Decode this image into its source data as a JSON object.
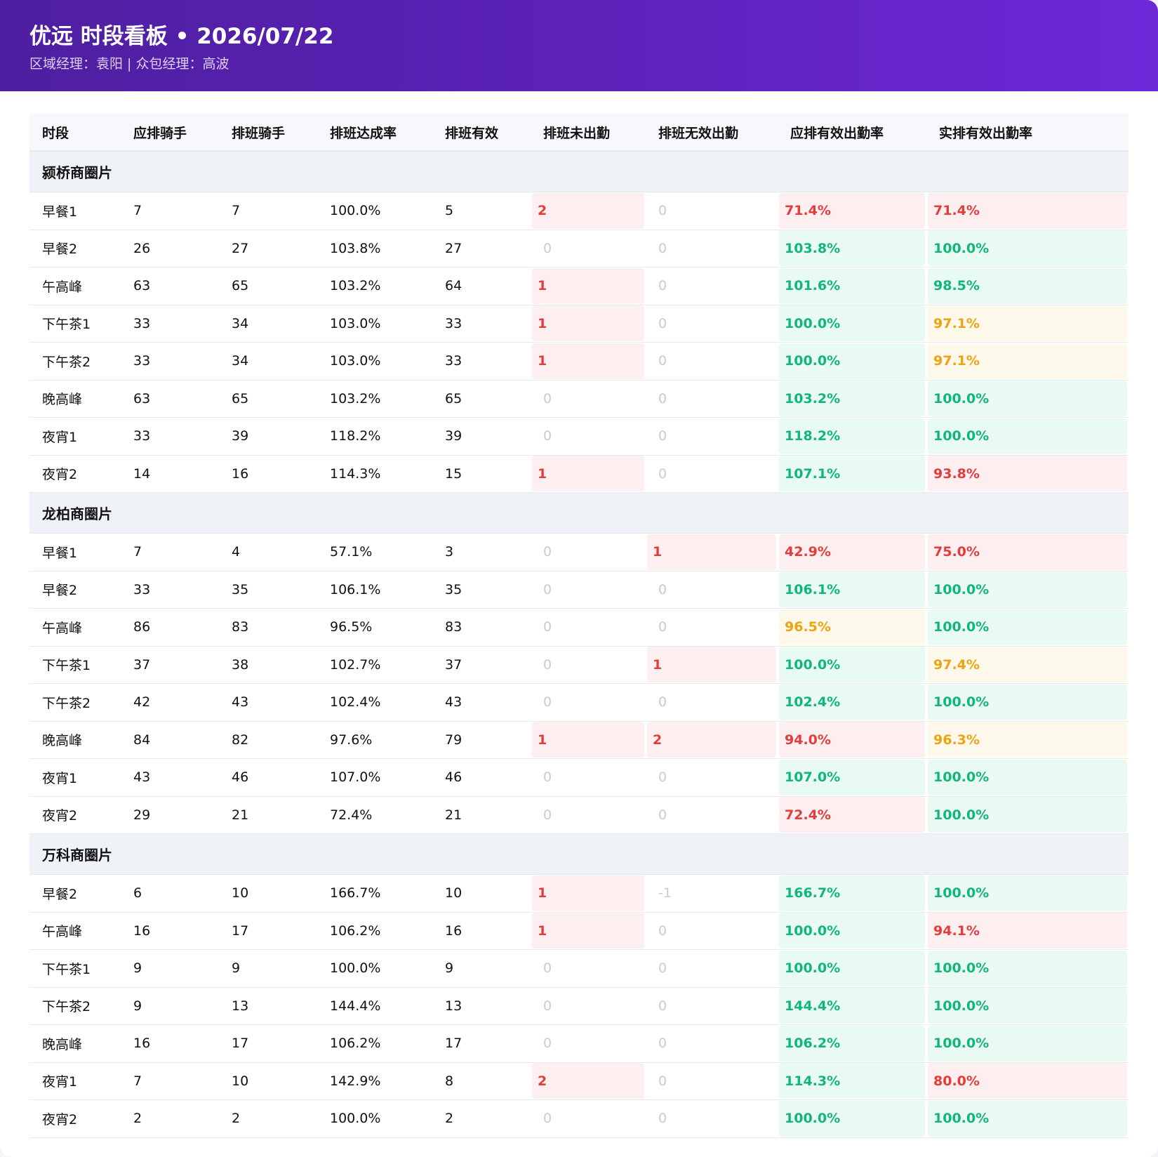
{
  "header": {
    "title": "优远 时段看板 • 2026/07/22",
    "subtitle": "区域经理：袁阳 | 众包经理：高波"
  },
  "columns": [
    "时段",
    "应排骑手",
    "排班骑手",
    "排班达成率",
    "排班有效",
    "排班未出勤",
    "排班无效出勤",
    "应排有效出勤率",
    "实排有效出勤率"
  ],
  "colors": {
    "red": "#e23c3c",
    "green": "#12b57a",
    "yellow": "#eea214",
    "header_start": "#4e1fa0",
    "header_end": "#6d28d9"
  },
  "groups": [
    {
      "name": "颍桥商圈片",
      "rows": [
        {
          "slot": "早餐1",
          "should": "7",
          "scheduled": "7",
          "rate": "100.0%",
          "valid": "5",
          "absent": "2",
          "invalid": "0",
          "should_rate": "71.4%",
          "actual_rate": "71.4%",
          "absent_status": "red",
          "invalid_status": "zero",
          "should_status": "red",
          "actual_status": "red"
        },
        {
          "slot": "早餐2",
          "should": "26",
          "scheduled": "27",
          "rate": "103.8%",
          "valid": "27",
          "absent": "0",
          "invalid": "0",
          "should_rate": "103.8%",
          "actual_rate": "100.0%",
          "absent_status": "zero",
          "invalid_status": "zero",
          "should_status": "green",
          "actual_status": "green"
        },
        {
          "slot": "午高峰",
          "should": "63",
          "scheduled": "65",
          "rate": "103.2%",
          "valid": "64",
          "absent": "1",
          "invalid": "0",
          "should_rate": "101.6%",
          "actual_rate": "98.5%",
          "absent_status": "red",
          "invalid_status": "zero",
          "should_status": "green",
          "actual_status": "green"
        },
        {
          "slot": "下午茶1",
          "should": "33",
          "scheduled": "34",
          "rate": "103.0%",
          "valid": "33",
          "absent": "1",
          "invalid": "0",
          "should_rate": "100.0%",
          "actual_rate": "97.1%",
          "absent_status": "red",
          "invalid_status": "zero",
          "should_status": "green",
          "actual_status": "yellow"
        },
        {
          "slot": "下午茶2",
          "should": "33",
          "scheduled": "34",
          "rate": "103.0%",
          "valid": "33",
          "absent": "1",
          "invalid": "0",
          "should_rate": "100.0%",
          "actual_rate": "97.1%",
          "absent_status": "red",
          "invalid_status": "zero",
          "should_status": "green",
          "actual_status": "yellow"
        },
        {
          "slot": "晚高峰",
          "should": "63",
          "scheduled": "65",
          "rate": "103.2%",
          "valid": "65",
          "absent": "0",
          "invalid": "0",
          "should_rate": "103.2%",
          "actual_rate": "100.0%",
          "absent_status": "zero",
          "invalid_status": "zero",
          "should_status": "green",
          "actual_status": "green"
        },
        {
          "slot": "夜宵1",
          "should": "33",
          "scheduled": "39",
          "rate": "118.2%",
          "valid": "39",
          "absent": "0",
          "invalid": "0",
          "should_rate": "118.2%",
          "actual_rate": "100.0%",
          "absent_status": "zero",
          "invalid_status": "zero",
          "should_status": "green",
          "actual_status": "green"
        },
        {
          "slot": "夜宵2",
          "should": "14",
          "scheduled": "16",
          "rate": "114.3%",
          "valid": "15",
          "absent": "1",
          "invalid": "0",
          "should_rate": "107.1%",
          "actual_rate": "93.8%",
          "absent_status": "red",
          "invalid_status": "zero",
          "should_status": "green",
          "actual_status": "red"
        }
      ]
    },
    {
      "name": "龙柏商圈片",
      "rows": [
        {
          "slot": "早餐1",
          "should": "7",
          "scheduled": "4",
          "rate": "57.1%",
          "valid": "3",
          "absent": "0",
          "invalid": "1",
          "should_rate": "42.9%",
          "actual_rate": "75.0%",
          "absent_status": "zero",
          "invalid_status": "red",
          "should_status": "red",
          "actual_status": "red"
        },
        {
          "slot": "早餐2",
          "should": "33",
          "scheduled": "35",
          "rate": "106.1%",
          "valid": "35",
          "absent": "0",
          "invalid": "0",
          "should_rate": "106.1%",
          "actual_rate": "100.0%",
          "absent_status": "zero",
          "invalid_status": "zero",
          "should_status": "green",
          "actual_status": "green"
        },
        {
          "slot": "午高峰",
          "should": "86",
          "scheduled": "83",
          "rate": "96.5%",
          "valid": "83",
          "absent": "0",
          "invalid": "0",
          "should_rate": "96.5%",
          "actual_rate": "100.0%",
          "absent_status": "zero",
          "invalid_status": "zero",
          "should_status": "yellow",
          "actual_status": "green"
        },
        {
          "slot": "下午茶1",
          "should": "37",
          "scheduled": "38",
          "rate": "102.7%",
          "valid": "37",
          "absent": "0",
          "invalid": "1",
          "should_rate": "100.0%",
          "actual_rate": "97.4%",
          "absent_status": "zero",
          "invalid_status": "red",
          "should_status": "green",
          "actual_status": "yellow"
        },
        {
          "slot": "下午茶2",
          "should": "42",
          "scheduled": "43",
          "rate": "102.4%",
          "valid": "43",
          "absent": "0",
          "invalid": "0",
          "should_rate": "102.4%",
          "actual_rate": "100.0%",
          "absent_status": "zero",
          "invalid_status": "zero",
          "should_status": "green",
          "actual_status": "green"
        },
        {
          "slot": "晚高峰",
          "should": "84",
          "scheduled": "82",
          "rate": "97.6%",
          "valid": "79",
          "absent": "1",
          "invalid": "2",
          "should_rate": "94.0%",
          "actual_rate": "96.3%",
          "absent_status": "red",
          "invalid_status": "red",
          "should_status": "red",
          "actual_status": "yellow"
        },
        {
          "slot": "夜宵1",
          "should": "43",
          "scheduled": "46",
          "rate": "107.0%",
          "valid": "46",
          "absent": "0",
          "invalid": "0",
          "should_rate": "107.0%",
          "actual_rate": "100.0%",
          "absent_status": "zero",
          "invalid_status": "zero",
          "should_status": "green",
          "actual_status": "green"
        },
        {
          "slot": "夜宵2",
          "should": "29",
          "scheduled": "21",
          "rate": "72.4%",
          "valid": "21",
          "absent": "0",
          "invalid": "0",
          "should_rate": "72.4%",
          "actual_rate": "100.0%",
          "absent_status": "zero",
          "invalid_status": "zero",
          "should_status": "red",
          "actual_status": "green"
        }
      ]
    },
    {
      "name": "万科商圈片",
      "rows": [
        {
          "slot": "早餐2",
          "should": "6",
          "scheduled": "10",
          "rate": "166.7%",
          "valid": "10",
          "absent": "1",
          "invalid": "-1",
          "should_rate": "166.7%",
          "actual_rate": "100.0%",
          "absent_status": "red",
          "invalid_status": "zero",
          "should_status": "green",
          "actual_status": "green"
        },
        {
          "slot": "午高峰",
          "should": "16",
          "scheduled": "17",
          "rate": "106.2%",
          "valid": "16",
          "absent": "1",
          "invalid": "0",
          "should_rate": "100.0%",
          "actual_rate": "94.1%",
          "absent_status": "red",
          "invalid_status": "zero",
          "should_status": "green",
          "actual_status": "red"
        },
        {
          "slot": "下午茶1",
          "should": "9",
          "scheduled": "9",
          "rate": "100.0%",
          "valid": "9",
          "absent": "0",
          "invalid": "0",
          "should_rate": "100.0%",
          "actual_rate": "100.0%",
          "absent_status": "zero",
          "invalid_status": "zero",
          "should_status": "green",
          "actual_status": "green"
        },
        {
          "slot": "下午茶2",
          "should": "9",
          "scheduled": "13",
          "rate": "144.4%",
          "valid": "13",
          "absent": "0",
          "invalid": "0",
          "should_rate": "144.4%",
          "actual_rate": "100.0%",
          "absent_status": "zero",
          "invalid_status": "zero",
          "should_status": "green",
          "actual_status": "green"
        },
        {
          "slot": "晚高峰",
          "should": "16",
          "scheduled": "17",
          "rate": "106.2%",
          "valid": "17",
          "absent": "0",
          "invalid": "0",
          "should_rate": "106.2%",
          "actual_rate": "100.0%",
          "absent_status": "zero",
          "invalid_status": "zero",
          "should_status": "green",
          "actual_status": "green"
        },
        {
          "slot": "夜宵1",
          "should": "7",
          "scheduled": "10",
          "rate": "142.9%",
          "valid": "8",
          "absent": "2",
          "invalid": "0",
          "should_rate": "114.3%",
          "actual_rate": "80.0%",
          "absent_status": "red",
          "invalid_status": "zero",
          "should_status": "green",
          "actual_status": "red"
        },
        {
          "slot": "夜宵2",
          "should": "2",
          "scheduled": "2",
          "rate": "100.0%",
          "valid": "2",
          "absent": "0",
          "invalid": "0",
          "should_rate": "100.0%",
          "actual_rate": "100.0%",
          "absent_status": "zero",
          "invalid_status": "zero",
          "should_status": "green",
          "actual_status": "green"
        }
      ]
    }
  ]
}
